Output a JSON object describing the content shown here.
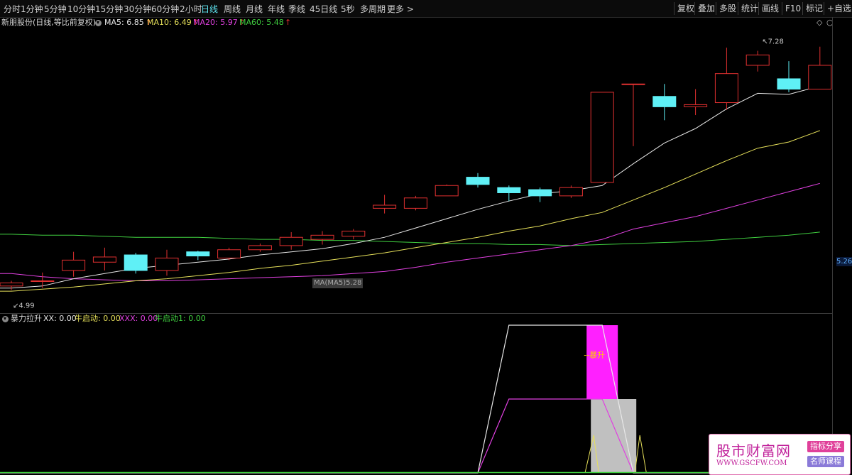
{
  "periods": [
    "分时",
    "1分钟",
    "5分钟",
    "10分钟",
    "15分钟",
    "30分钟",
    "60分钟",
    "2小时",
    "日线",
    "周线",
    "月线",
    "年线",
    "季线",
    "45日线",
    "5秒",
    "多周期",
    "更多 >"
  ],
  "active_period": "日线",
  "tools": [
    "复权",
    "叠加",
    "多股",
    "统计",
    "画线",
    "F10",
    "标记",
    "+自选"
  ],
  "stock": {
    "title": "新朋股份(日线,等比前复权)"
  },
  "ma_legend": [
    {
      "label": "MA5: 6.85",
      "color": "#e8e8e8"
    },
    {
      "label": "MA10: 6.49",
      "color": "#e6e05a"
    },
    {
      "label": "MA20: 5.97",
      "color": "#e040e0"
    },
    {
      "label": "MA60: 5.48",
      "color": "#40d040"
    }
  ],
  "up_arrow": "↑",
  "price_axis_label": "5.26",
  "high_label": "7.28",
  "low_label": "4.99",
  "ma_tag": "MA(MA5)5.28",
  "indicator": {
    "name": "暴力拉升",
    "fields": [
      {
        "label": "XX: 0.00",
        "color": "#e8e8e8"
      },
      {
        "label": "牛启动: 0.00",
        "color": "#e6e05a"
      },
      {
        "label": "XXX: 0.00",
        "color": "#e040e0"
      },
      {
        "label": "牛启动1: 0.00",
        "color": "#40d040"
      }
    ],
    "annotation": "--暴升"
  },
  "watermark": {
    "title": "股市财富网",
    "url": "WWW.GSCFW.COM",
    "tag1": "指标分享",
    "tag2": "名师课程"
  },
  "colors": {
    "up": "#e03030",
    "down": "#5ff0f6",
    "ma5": "#e8e8e8",
    "ma10": "#e6e05a",
    "ma20": "#e040e0",
    "ma60": "#40d040",
    "active": "#5fe6f2"
  },
  "candles": [
    {
      "o": 5.05,
      "c": 5.08,
      "h": 5.1,
      "l": 5.01
    },
    {
      "o": 5.1,
      "c": 5.1,
      "h": 5.18,
      "l": 5.03
    },
    {
      "o": 5.2,
      "c": 5.3,
      "h": 5.38,
      "l": 5.14
    },
    {
      "o": 5.28,
      "c": 5.33,
      "h": 5.42,
      "l": 5.2
    },
    {
      "o": 5.35,
      "c": 5.2,
      "h": 5.37,
      "l": 5.17
    },
    {
      "o": 5.2,
      "c": 5.32,
      "h": 5.4,
      "l": 5.15
    },
    {
      "o": 5.38,
      "c": 5.34,
      "h": 5.39,
      "l": 5.3
    },
    {
      "o": 5.32,
      "c": 5.4,
      "h": 5.42,
      "l": 5.3
    },
    {
      "o": 5.4,
      "c": 5.44,
      "h": 5.46,
      "l": 5.38
    },
    {
      "o": 5.44,
      "c": 5.52,
      "h": 5.57,
      "l": 5.4
    },
    {
      "o": 5.5,
      "c": 5.54,
      "h": 5.58,
      "l": 5.45
    },
    {
      "o": 5.53,
      "c": 5.58,
      "h": 5.6,
      "l": 5.5
    },
    {
      "o": 5.8,
      "c": 5.83,
      "h": 5.93,
      "l": 5.75
    },
    {
      "o": 5.8,
      "c": 5.9,
      "h": 5.92,
      "l": 5.78
    },
    {
      "o": 5.92,
      "c": 6.02,
      "h": 6.03,
      "l": 5.92
    },
    {
      "o": 6.1,
      "c": 6.03,
      "h": 6.14,
      "l": 6.0
    },
    {
      "o": 6.0,
      "c": 5.95,
      "h": 6.02,
      "l": 5.87
    },
    {
      "o": 5.98,
      "c": 5.92,
      "h": 6.0,
      "l": 5.86
    },
    {
      "o": 5.92,
      "c": 6.0,
      "h": 6.02,
      "l": 5.9
    },
    {
      "o": 6.05,
      "c": 6.92,
      "h": 6.92,
      "l": 6.05
    },
    {
      "o": 7.0,
      "c": 7.0,
      "h": 7.0,
      "l": 6.4
    },
    {
      "o": 6.88,
      "c": 6.78,
      "h": 7.0,
      "l": 6.65
    },
    {
      "o": 6.78,
      "c": 6.8,
      "h": 6.95,
      "l": 6.7
    },
    {
      "o": 6.82,
      "c": 7.1,
      "h": 7.35,
      "l": 6.75
    },
    {
      "o": 7.18,
      "c": 7.28,
      "h": 7.32,
      "l": 7.12
    },
    {
      "o": 7.05,
      "c": 6.95,
      "h": 7.22,
      "l": 6.92
    },
    {
      "o": 6.95,
      "c": 7.18,
      "h": 7.36,
      "l": 6.95
    }
  ],
  "ma_series": {
    "ma5": [
      5.03,
      5.05,
      5.12,
      5.17,
      5.22,
      5.25,
      5.28,
      5.31,
      5.35,
      5.38,
      5.41,
      5.46,
      5.52,
      5.61,
      5.7,
      5.79,
      5.87,
      5.94,
      5.97,
      6.02,
      6.23,
      6.43,
      6.57,
      6.76,
      6.91,
      6.9,
      6.98
    ],
    "ma10": [
      5.0,
      5.02,
      5.04,
      5.07,
      5.1,
      5.12,
      5.15,
      5.18,
      5.22,
      5.25,
      5.29,
      5.33,
      5.37,
      5.42,
      5.47,
      5.52,
      5.58,
      5.63,
      5.7,
      5.76,
      5.88,
      6.0,
      6.13,
      6.26,
      6.38,
      6.44,
      6.55
    ],
    "ma20": [
      5.17,
      5.14,
      5.12,
      5.11,
      5.1,
      5.1,
      5.11,
      5.12,
      5.13,
      5.14,
      5.15,
      5.17,
      5.19,
      5.23,
      5.28,
      5.32,
      5.36,
      5.4,
      5.44,
      5.5,
      5.6,
      5.66,
      5.72,
      5.8,
      5.88,
      5.96,
      6.04
    ],
    "ma60": [
      5.55,
      5.54,
      5.54,
      5.53,
      5.52,
      5.52,
      5.52,
      5.51,
      5.5,
      5.5,
      5.49,
      5.49,
      5.48,
      5.47,
      5.46,
      5.46,
      5.45,
      5.45,
      5.44,
      5.45,
      5.46,
      5.47,
      5.48,
      5.5,
      5.52,
      5.54,
      5.57
    ]
  },
  "indicator_series": {
    "xx": [
      0,
      0,
      0,
      0,
      0,
      0,
      0,
      0,
      0,
      0,
      0,
      0,
      0,
      0,
      0,
      0,
      1,
      1,
      1,
      1,
      0,
      0,
      0,
      0,
      0,
      0,
      0
    ],
    "xxx": [
      0,
      0,
      0,
      0,
      0,
      0,
      0,
      0,
      0,
      0,
      0,
      0,
      0,
      0,
      0,
      0,
      0.5,
      0.5,
      0.5,
      0.5,
      0,
      0,
      0,
      0,
      0,
      0,
      0
    ],
    "spike": [
      0,
      0,
      0,
      0,
      0,
      0,
      0,
      0,
      0,
      0,
      0,
      0,
      0,
      0,
      0,
      0,
      0,
      0,
      0,
      1,
      0,
      0,
      0,
      0,
      0,
      0,
      0
    ],
    "block": [
      0,
      0,
      0,
      0,
      0,
      0,
      0,
      0,
      0,
      0,
      0,
      0,
      0,
      0,
      0,
      0,
      0,
      0,
      0,
      1,
      0,
      0,
      0,
      0,
      0,
      0,
      0
    ]
  }
}
